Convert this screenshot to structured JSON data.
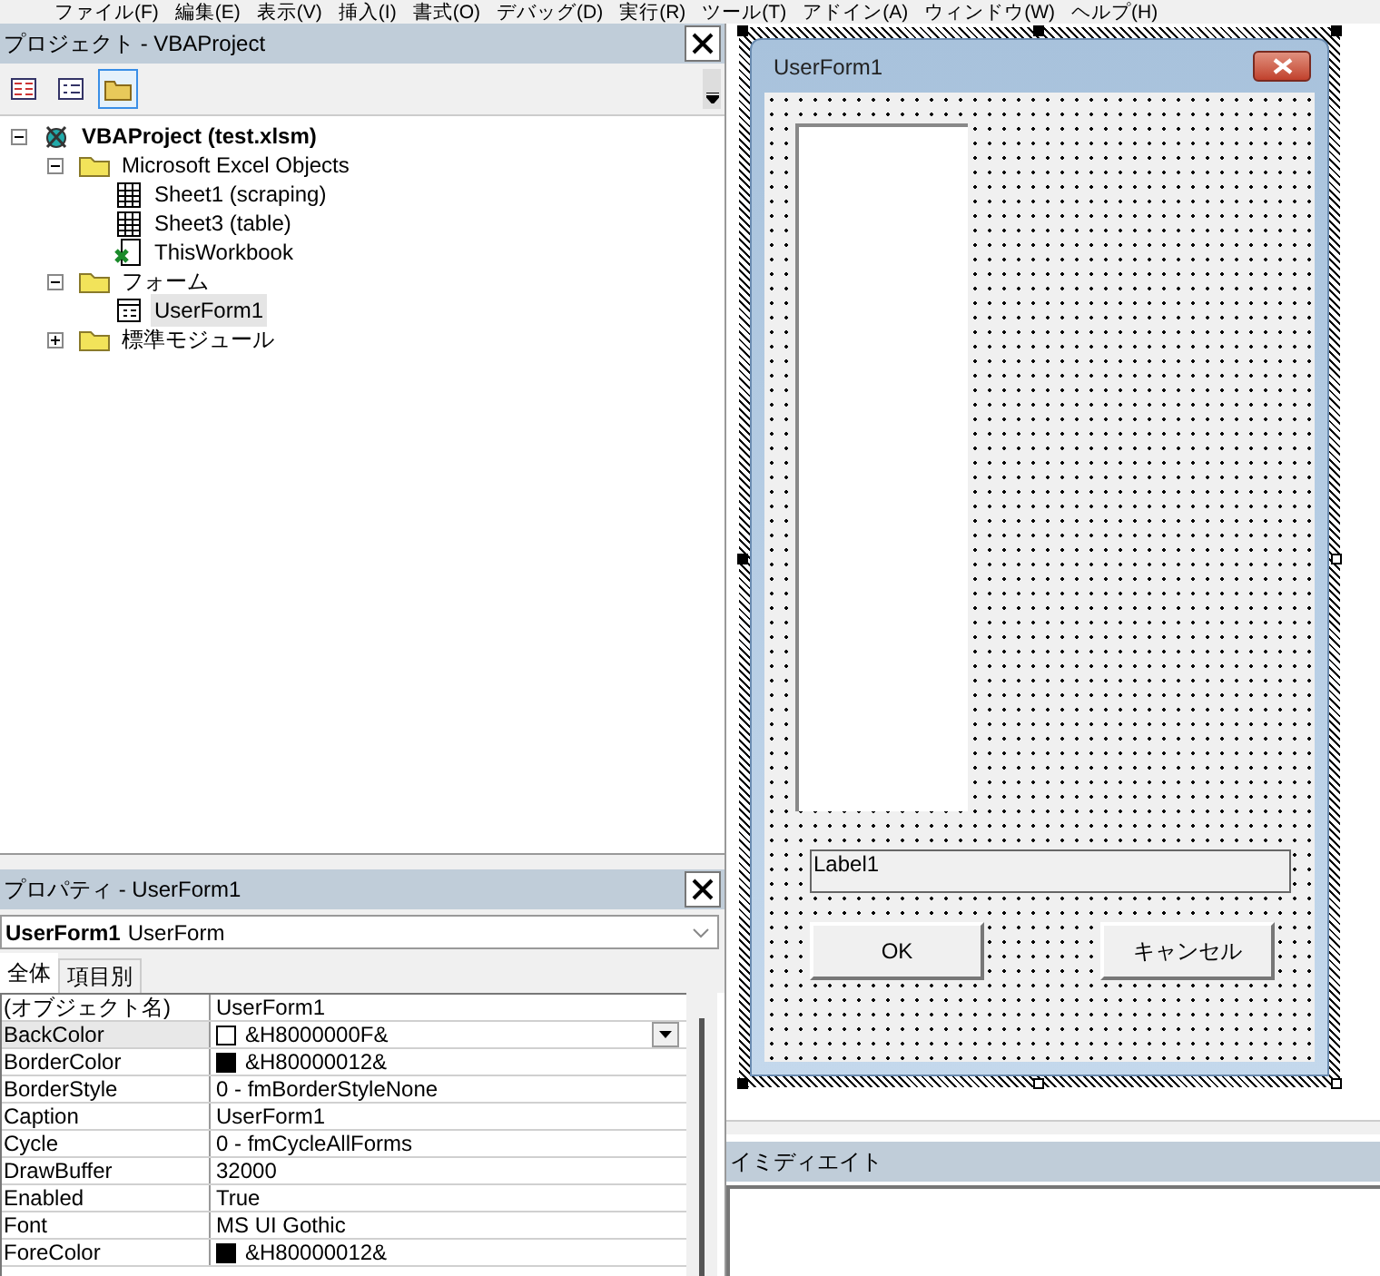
{
  "menu": [
    "ファイル(F)",
    "編集(E)",
    "表示(V)",
    "挿入(I)",
    "書式(O)",
    "デバッグ(D)",
    "実行(R)",
    "ツール(T)",
    "アドイン(A)",
    "ウィンドウ(W)",
    "ヘルプ(H)"
  ],
  "project": {
    "title": "プロジェクト - VBAProject",
    "toolbar": [
      {
        "kind": "code",
        "selected": false
      },
      {
        "kind": "object",
        "selected": false
      },
      {
        "kind": "folder",
        "selected": true
      }
    ],
    "tree": [
      {
        "label": "VBAProject (test.xlsm)",
        "kind": "project",
        "expanded": true,
        "selected": false,
        "children": [
          {
            "label": "Microsoft Excel Objects",
            "kind": "folder",
            "expanded": true,
            "selected": false,
            "children": [
              {
                "label": "Sheet1 (scraping)",
                "kind": "sheet",
                "selected": false
              },
              {
                "label": "Sheet3 (table)",
                "kind": "sheet",
                "selected": false
              },
              {
                "label": "ThisWorkbook",
                "kind": "workbook",
                "selected": false
              }
            ]
          },
          {
            "label": "フォーム",
            "kind": "folder",
            "expanded": true,
            "selected": false,
            "children": [
              {
                "label": "UserForm1",
                "kind": "form",
                "selected": true
              }
            ]
          },
          {
            "label": "標準モジュール",
            "kind": "folder",
            "expanded": false,
            "selected": false
          }
        ]
      }
    ]
  },
  "properties": {
    "title": "プロパティ - UserForm1",
    "object_name": "UserForm1",
    "object_type": "UserForm",
    "tabs": [
      {
        "label": "全体",
        "selected": true
      },
      {
        "label": "項目別",
        "selected": false
      }
    ],
    "rows": [
      {
        "name": "(オブジェクト名)",
        "value": "UserForm1",
        "selected": false
      },
      {
        "name": "BackColor",
        "value": "&H8000000F&",
        "color": "#ffffff",
        "selected": true
      },
      {
        "name": "BorderColor",
        "value": "&H80000012&",
        "color": "#000000",
        "selected": false
      },
      {
        "name": "BorderStyle",
        "value": "0 - fmBorderStyleNone",
        "selected": false
      },
      {
        "name": "Caption",
        "value": "UserForm1",
        "selected": false
      },
      {
        "name": "Cycle",
        "value": "0 - fmCycleAllForms",
        "selected": false
      },
      {
        "name": "DrawBuffer",
        "value": "32000",
        "selected": false
      },
      {
        "name": "Enabled",
        "value": "True",
        "selected": false
      },
      {
        "name": "Font",
        "value": "MS UI Gothic",
        "selected": false
      },
      {
        "name": "ForeColor",
        "value": "&H80000012&",
        "color": "#000000",
        "selected": false
      }
    ]
  },
  "form": {
    "title": "UserForm1",
    "label": "Label1",
    "buttons": [
      "OK",
      "キャンセル"
    ]
  },
  "immediate": {
    "title": "イミディエイト"
  }
}
